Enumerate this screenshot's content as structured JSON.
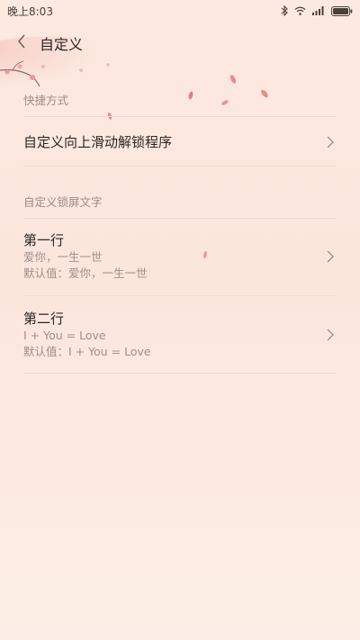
{
  "status_bar": {
    "time": "晚上8:03",
    "icons": [
      "bluetooth-icon",
      "wifi-icon",
      "signal-icon",
      "battery-icon"
    ]
  },
  "header": {
    "title": "自定义",
    "back_icon": "chevron-left-icon"
  },
  "sections": [
    {
      "header": "快捷方式",
      "items": [
        {
          "title": "自定义向上滑动解锁程序"
        }
      ]
    },
    {
      "header": "自定义锁屏文字",
      "items": [
        {
          "title": "第一行",
          "value": "爱你，一生一世",
          "default": "默认值：爱你，一生一世"
        },
        {
          "title": "第二行",
          "value": "I + You = Love",
          "default": "默认值：I + You = Love"
        }
      ]
    }
  ],
  "colors": {
    "background": "#fbe6dc",
    "accent_petal": "#e98a8c",
    "text_primary": "#2d2523",
    "text_secondary": "#a08f89"
  }
}
